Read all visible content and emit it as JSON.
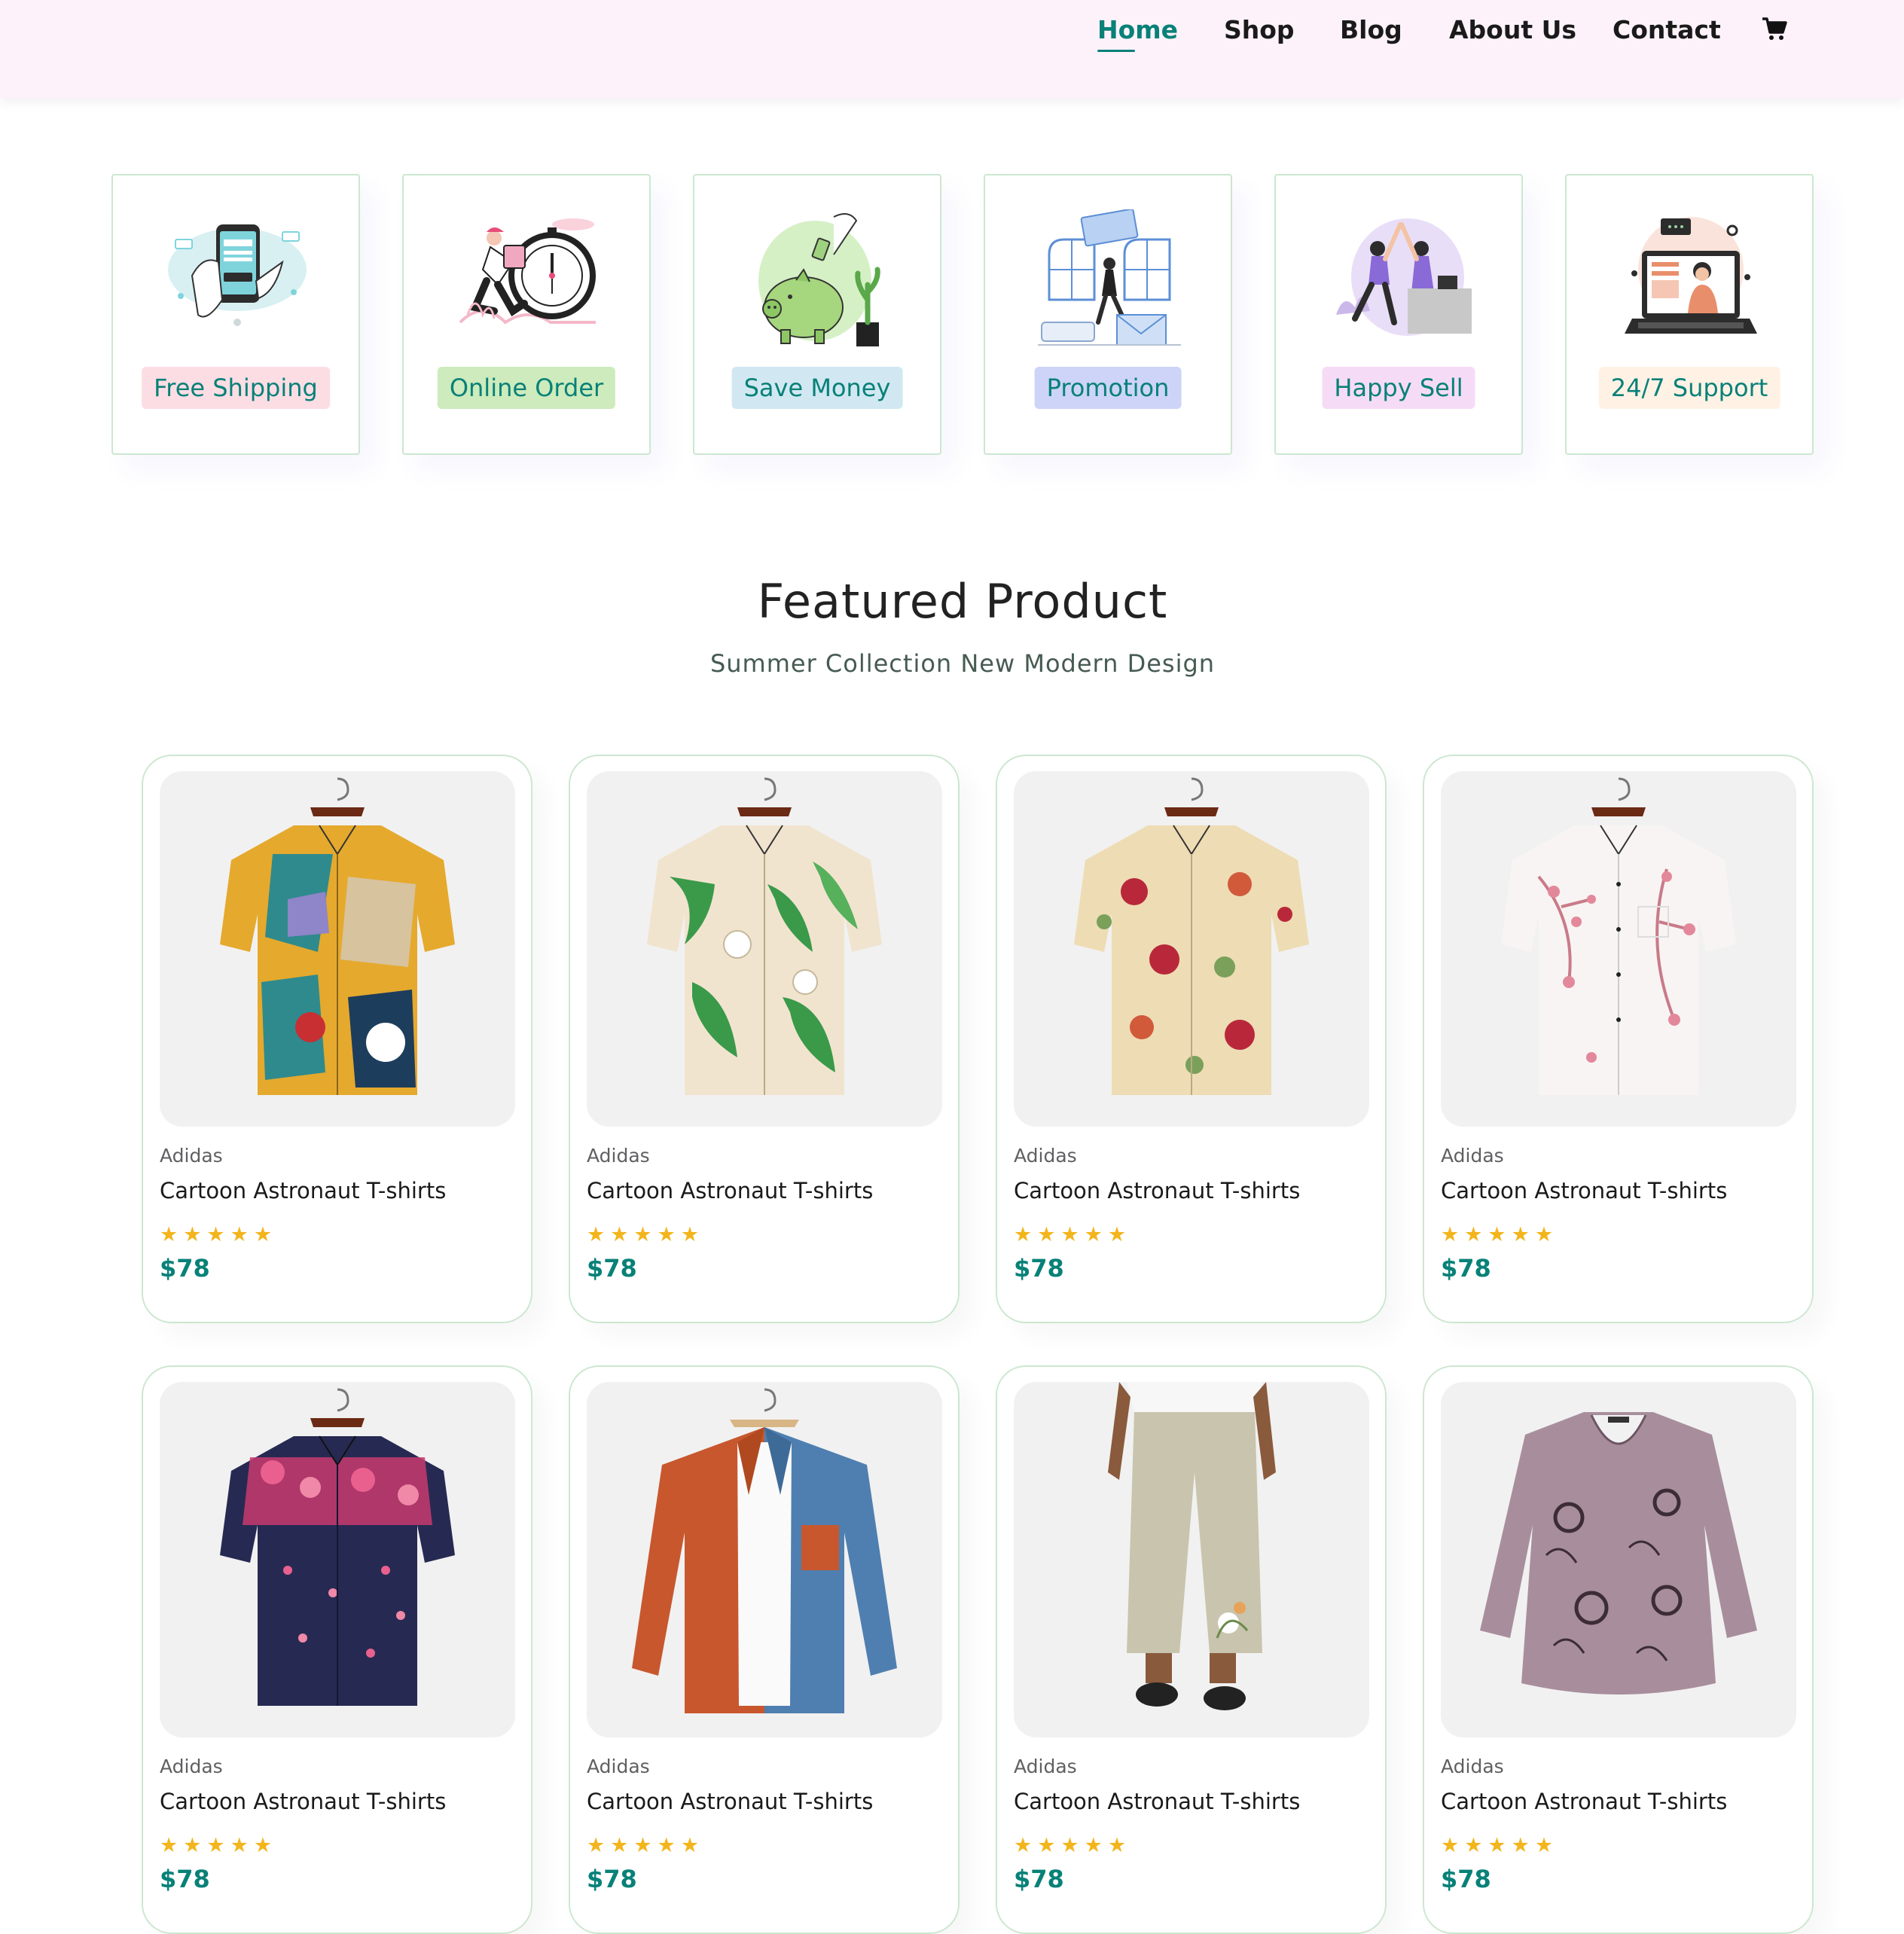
{
  "header": {
    "nav": [
      {
        "label": "Home",
        "active": true
      },
      {
        "label": "Shop",
        "active": false
      },
      {
        "label": "Blog",
        "active": false
      },
      {
        "label": "About Us",
        "active": false
      },
      {
        "label": "Contact",
        "active": false
      }
    ],
    "cart_icon": "shopping-cart-icon"
  },
  "features": [
    {
      "label": "Free Shipping",
      "bg": "#fddde4",
      "icon": "payment-phone-illustration"
    },
    {
      "label": "Online Order",
      "bg": "#cdebbc",
      "icon": "clock-delivery-illustration"
    },
    {
      "label": "Save Money",
      "bg": "#d1e8f2",
      "icon": "piggy-bank-illustration"
    },
    {
      "label": "Promotion",
      "bg": "#cdd4f8",
      "icon": "promotion-illustration"
    },
    {
      "label": "Happy Sell",
      "bg": "#f6dbf6",
      "icon": "high-five-illustration"
    },
    {
      "label": "24/7 Support",
      "bg": "#fff2e5",
      "icon": "laptop-support-illustration"
    }
  ],
  "section": {
    "title": "Featured Product",
    "subtitle": "Summer Collection New Modern Design"
  },
  "products": [
    {
      "brand": "Adidas",
      "name": "Cartoon Astronaut T-shirts",
      "rating": 5,
      "price": "$78",
      "image": "colorful-abstract-shirt"
    },
    {
      "brand": "Adidas",
      "name": "Cartoon Astronaut T-shirts",
      "rating": 5,
      "price": "$78",
      "image": "green-leaf-floral-shirt"
    },
    {
      "brand": "Adidas",
      "name": "Cartoon Astronaut T-shirts",
      "rating": 5,
      "price": "$78",
      "image": "red-rose-floral-shirt"
    },
    {
      "brand": "Adidas",
      "name": "Cartoon Astronaut T-shirts",
      "rating": 5,
      "price": "$78",
      "image": "white-cherry-blossom-shirt"
    },
    {
      "brand": "Adidas",
      "name": "Cartoon Astronaut T-shirts",
      "rating": 5,
      "price": "$78",
      "image": "navy-pink-floral-shirt"
    },
    {
      "brand": "Adidas",
      "name": "Cartoon Astronaut T-shirts",
      "rating": 5,
      "price": "$78",
      "image": "orange-blue-jacket"
    },
    {
      "brand": "Adidas",
      "name": "Cartoon Astronaut T-shirts",
      "rating": 5,
      "price": "$78",
      "image": "beige-linen-pants"
    },
    {
      "brand": "Adidas",
      "name": "Cartoon Astronaut T-shirts",
      "rating": 5,
      "price": "$78",
      "image": "mauve-cat-print-blouse"
    }
  ],
  "colors": {
    "accent": "#088178",
    "star": "#f3b51c",
    "header_bg": "#fdf2fa",
    "border": "#cce7d0"
  }
}
